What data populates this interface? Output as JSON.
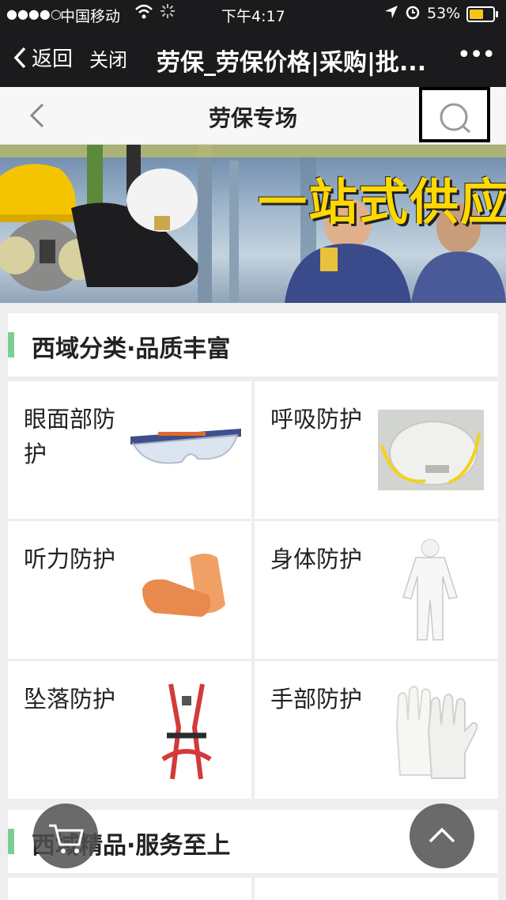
{
  "status_bar": {
    "signal": "●●●●○",
    "carrier": "中国移动",
    "time": "下午4:17",
    "battery_pct": "53%"
  },
  "nav": {
    "back_label": "返回",
    "close_label": "关闭",
    "title": "劳保_劳保价格|采购|批...",
    "more": "•••"
  },
  "header": {
    "title": "劳保专场"
  },
  "banner": {
    "slogan": "一站式供应"
  },
  "section1": {
    "title": "西域分类·品质丰富",
    "categories": [
      {
        "label": "眼面部防\n护",
        "icon": "safety-goggles"
      },
      {
        "label": "呼吸防护",
        "icon": "dust-mask"
      },
      {
        "label": "听力防护",
        "icon": "earplugs"
      },
      {
        "label": "身体防护",
        "icon": "protective-coverall"
      },
      {
        "label": "坠落防护",
        "icon": "safety-harness"
      },
      {
        "label": "手部防护",
        "icon": "work-gloves"
      }
    ]
  },
  "section2": {
    "title": "西域精品·服务至上"
  },
  "colors": {
    "accent_green": "#7ccf92",
    "navbar_bg": "#1b1b1d",
    "banner_yellow": "#ffd800"
  }
}
